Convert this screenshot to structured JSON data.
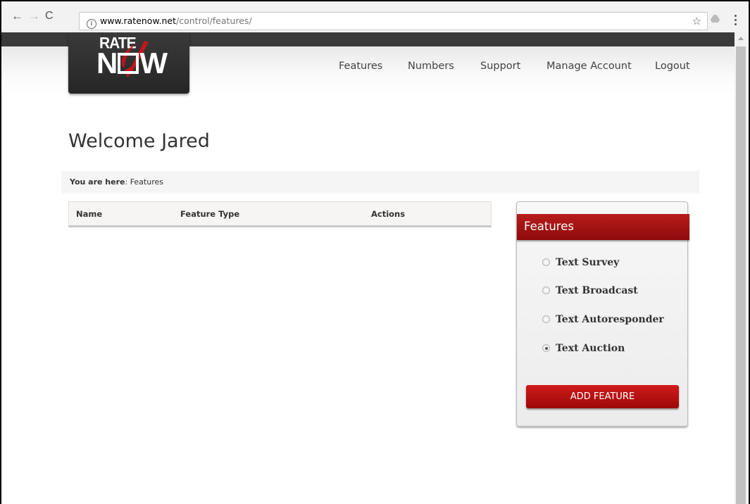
{
  "browser": {
    "url_host": "www.ratenow.net",
    "url_path": "/control/features/",
    "back_icon": "←",
    "forward_icon": "→",
    "reload_icon": "C",
    "info_icon": "i",
    "star_icon": "☆"
  },
  "logo": {
    "line1": "RATE",
    "line2_a": "N",
    "line2_b": "W"
  },
  "nav": {
    "items": [
      {
        "label": "Features"
      },
      {
        "label": "Numbers"
      },
      {
        "label": "Support"
      },
      {
        "label": "Manage Account"
      },
      {
        "label": "Logout"
      }
    ]
  },
  "page": {
    "welcome": "Welcome Jared"
  },
  "breadcrumb": {
    "prefix": "You are here",
    "current": "Features"
  },
  "table": {
    "headers": [
      "Name",
      "Feature Type",
      "Actions"
    ]
  },
  "features_panel": {
    "title": "Features",
    "options": [
      {
        "label": "Text Survey",
        "checked": false
      },
      {
        "label": "Text Broadcast",
        "checked": false
      },
      {
        "label": "Text Autoresponder",
        "checked": false
      },
      {
        "label": "Text Auction",
        "checked": true
      }
    ],
    "button_label": "ADD FEATURE"
  },
  "colors": {
    "brand_red": "#a50f0f",
    "header_dark": "#3a3a3a"
  }
}
